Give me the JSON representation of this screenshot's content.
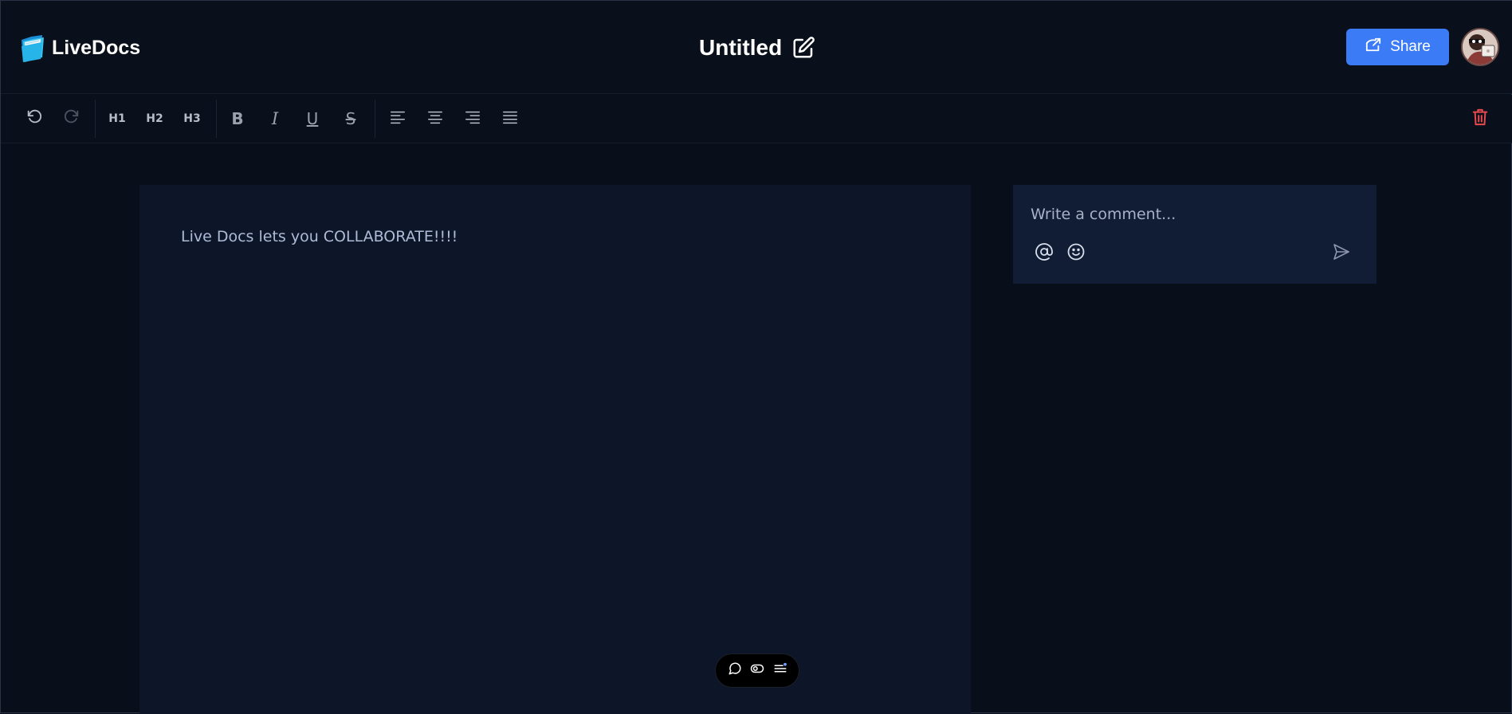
{
  "app": {
    "brand_name": "LiveDocs",
    "brand_icon": "folder-logo-icon"
  },
  "document": {
    "title": "Untitled",
    "edit_icon": "edit-title-icon",
    "body_text": "Live Docs lets you COLLABORATE!!!!"
  },
  "header": {
    "share_label": "Share",
    "share_icon": "share-icon",
    "avatar_icon": "user-avatar"
  },
  "toolbar": {
    "undo_icon": "undo-icon",
    "redo_icon": "redo-icon",
    "h1_label": "H1",
    "h2_label": "H2",
    "h3_label": "H3",
    "bold_label": "B",
    "italic_label": "I",
    "underline_label": "U",
    "strike_label": "S",
    "align_left_icon": "align-left-icon",
    "align_center_icon": "align-center-icon",
    "align_right_icon": "align-right-icon",
    "align_justify_icon": "align-justify-icon",
    "delete_icon": "trash-icon"
  },
  "comments": {
    "placeholder": "Write a comment...",
    "mention_icon": "at-sign-icon",
    "emoji_icon": "emoji-icon",
    "send_icon": "send-icon"
  },
  "floating_bar": {
    "comment_icon": "comment-icon",
    "toggle_icon": "toggle-icon",
    "threads_icon": "threads-icon"
  },
  "colors": {
    "background": "#090f1a",
    "header": "#0a101b",
    "editor": "#0d1628",
    "comment_box": "#101d35",
    "accent": "#3b7bf6",
    "danger": "#e5484d"
  }
}
